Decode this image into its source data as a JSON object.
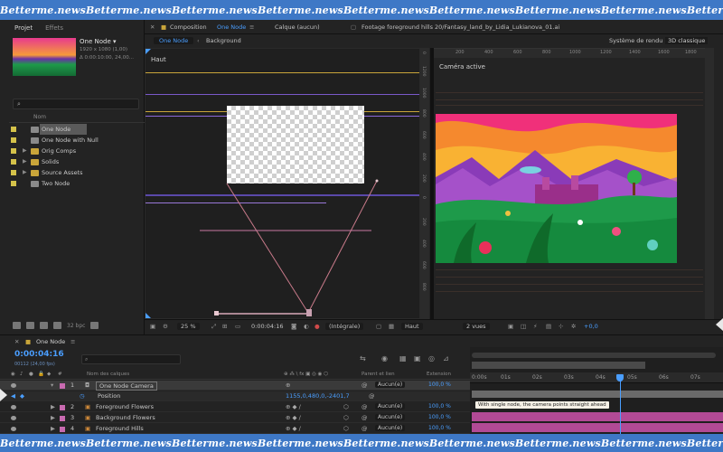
{
  "watermark": "Betterme.news",
  "colors": {
    "accent": "#4a9eff",
    "banner": "#3e78c6",
    "label_yellow": "#d4c24a",
    "label_pink": "#c86ab0",
    "track_pink": "#b24a95",
    "track_gray": "#6a6a6a"
  },
  "project_panel": {
    "tabs": [
      "Projet",
      "Effets"
    ],
    "comp_name": "One Node ▾",
    "comp_details": [
      "1920 x 1080 (1,00)",
      "Δ 0:00:10:00, 24,00..."
    ],
    "search_placeholder": "",
    "column_name": "Nom",
    "items": [
      {
        "name": "One Node",
        "type": "comp",
        "label": "yellow",
        "selected": true
      },
      {
        "name": "One Node with Null",
        "type": "comp",
        "label": "yellow"
      },
      {
        "name": "Orig Comps",
        "type": "folder",
        "label": "yellow"
      },
      {
        "name": "Solids",
        "type": "folder",
        "label": "yellow"
      },
      {
        "name": "Source Assets",
        "type": "folder",
        "label": "yellow"
      },
      {
        "name": "Two Node",
        "type": "comp",
        "label": "yellow"
      }
    ],
    "bpc": "32 bpc"
  },
  "comp_panel": {
    "composition_prefix": "Composition",
    "composition_name": "One Node",
    "layer_tab": "Calque (aucun)",
    "footage_tab": "Footage foreground hills 20/Fantasy_land_by_Lidia_Lukianova_01.ai",
    "breadcrumb_active": "One Node",
    "breadcrumb_next": "Background",
    "renderer_label": "Système de rendu :",
    "renderer_value": "3D classique",
    "left_view_label": "Haut",
    "right_view_label": "Caméra active",
    "ruler_h": [
      "200",
      "400",
      "600",
      "800",
      "1000",
      "1200",
      "1400",
      "1600",
      "1800"
    ],
    "ruler_v_left": [
      "0",
      "1200",
      "1000",
      "800",
      "600",
      "400",
      "200",
      "0",
      "200",
      "400",
      "600",
      "800",
      "1000",
      "1200",
      "1400"
    ]
  },
  "viewer_footer": {
    "zoom": "25 %",
    "timecode": "0:00:04:16",
    "resolution": "(Intégrale)",
    "view": "Haut",
    "views": "2 vues",
    "exposure": "+0,0"
  },
  "timeline": {
    "tab": "One Node",
    "timecode": "0:00:04:16",
    "timecode_sub": "00112 (24,00 fps)",
    "columns": {
      "name": "Nom des calques",
      "parent": "Parent et lien",
      "extension": "Extension"
    },
    "ruler": [
      "0:00s",
      "01s",
      "02s",
      "03s",
      "04s",
      "05s",
      "06s",
      "07s"
    ],
    "layers": [
      {
        "num": "1",
        "name": "One Node Camera",
        "parent": "Aucun(e)",
        "stretch": "100,0 %",
        "label": "pink",
        "selected": true
      },
      {
        "num": "",
        "name": "Position",
        "value": "1155,0,480,0,-2401,7",
        "property": true
      },
      {
        "num": "2",
        "name": "Foreground Flowers",
        "parent": "Aucun(e)",
        "stretch": "100,0 %",
        "label": "pink"
      },
      {
        "num": "3",
        "name": "Background Flowers",
        "parent": "Aucun(e)",
        "stretch": "100,0 %",
        "label": "pink"
      },
      {
        "num": "4",
        "name": "Foreground Hills",
        "parent": "Aucun(e)",
        "stretch": "100,0 %",
        "label": "pink"
      }
    ],
    "annotation": "With single node, the camera points straight ahead"
  }
}
